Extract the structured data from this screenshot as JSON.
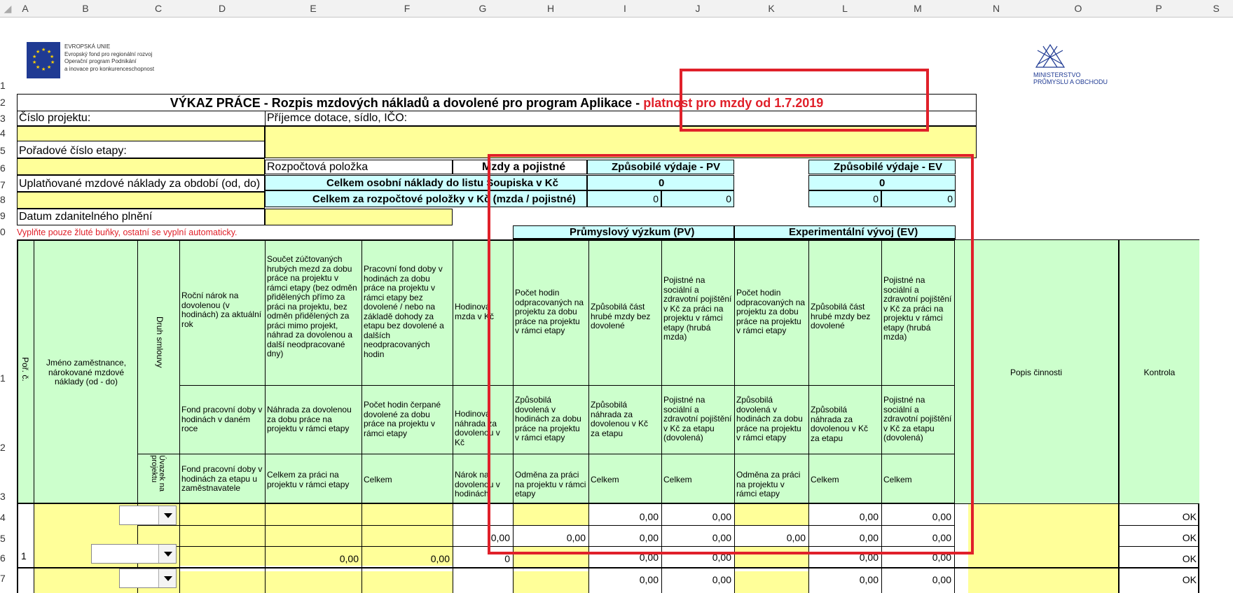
{
  "columns": [
    "A",
    "B",
    "C",
    "D",
    "E",
    "F",
    "G",
    "H",
    "I",
    "J",
    "K",
    "L",
    "M",
    "N",
    "O",
    "P",
    "S"
  ],
  "rows": [
    "1",
    "2",
    "3",
    "4",
    "5",
    "6",
    "7",
    "8",
    "9",
    "0",
    "1",
    "2",
    "3",
    "4",
    "5",
    "6",
    "7"
  ],
  "logo_eu": {
    "l1": "EVROPSKÁ UNIE",
    "l2": "Evropský fond pro regionální rozvoj",
    "l3": "Operační program Podnikání",
    "l4": "a inovace pro konkurenceschopnost"
  },
  "logo_mpo": {
    "l1": "MINISTERSTVO",
    "l2": "PRŮMYSLU A OBCHODU"
  },
  "title": {
    "main": "VÝKAZ PRÁCE - Rozpis mzdových nákladů a dovolené pro program Aplikace - ",
    "red": "platnost pro mzdy od 1.7.2019"
  },
  "labels": {
    "cislo_projektu": "Číslo projektu:",
    "prijemce": "Příjemce dotace, sídlo, IČO:",
    "poradove": "Pořadové číslo etapy:",
    "rozpoctova": "Rozpočtová položka",
    "mzdy": "Mzdy a pojistné",
    "zpusobile_pv": "Způsobilé výdaje - PV",
    "zpusobile_ev": "Způsobilé výdaje - EV",
    "uplatnovane": "Uplatňované mzdové náklady za období (od, do)",
    "celkem_osobni": "Celkem osobní náklady do listu Soupiska v Kč",
    "celkem_rozpoct": "Celkem za rozpočtové položky v Kč (mzda / pojistné)",
    "datum": "Datum zdanitelného plnění",
    "vyplnte": "Vyplňte pouze žluté buňky, ostatní se vyplní automaticky.",
    "prumyslovy": "Průmyslový výzkum (PV)",
    "experimentalni": "Experimentální vývoj (EV)"
  },
  "values": {
    "pv_total": "0",
    "ev_total": "0",
    "zero": "0",
    "num": "0,00",
    "ok": "OK",
    "one": "1"
  },
  "headers": {
    "por": "Poř. č.",
    "jmeno": "Jméno zaměstnance, nárokované mzdové náklady (od - do)",
    "druh": "Druh smlouvy",
    "uvazek": "Úvazek na projektu",
    "d1": "Roční nárok na dovolenou (v hodinách) za aktuální rok",
    "d2": "Fond pracovní doby v hodinách v daném roce",
    "d3": "Fond pracovní doby v hodinách za etapu u zaměstnavatele",
    "e1": "Součet zúčtovaných hrubých mezd za dobu práce na projektu v rámci etapy (bez odměn přidělených přímo za práci na projektu, bez odměn přidělených za práci mimo projekt, náhrad za dovolenou a další neodpracované dny)",
    "e2": "Náhrada za dovolenou za dobu práce na projektu v rámci etapy",
    "e3": "Celkem za práci na projektu v rámci etapy",
    "f1": "Pracovní fond doby v hodinách za dobu práce na projektu v rámci etapy bez dovolené / nebo na základě dohody za etapu bez dovolené a dalších neodpracovaných hodin",
    "f2": "Počet hodin čerpané dovolené za dobu práce na projektu v rámci etapy",
    "f3": "Celkem",
    "g1": "Hodinová mzda v Kč",
    "g2": "Hodinová náhrada za dovolenou v Kč",
    "g3": "Nárok na dovolenou v hodinách",
    "h1": "Počet hodin odpracovaných na projektu za dobu práce na projektu v rámci etapy",
    "h2": "Způsobilá dovolená v hodinách za dobu práce na projektu v rámci etapy",
    "h3": "Odměna za práci na projektu v rámci etapy",
    "i1": "Způsobilá část hrubé mzdy bez dovolené",
    "i2": "Způsobilá náhrada za dovolenou v Kč za etapu",
    "i3": "Celkem",
    "j1": "Pojistné na sociální a zdravotní pojištění v Kč za práci na projektu v rámci etapy (hrubá mzda)",
    "j2": "Pojistné na sociální a zdravotní pojištění v Kč za etapu (dovolená)",
    "j3": "Celkem",
    "k1": "Počet hodin odpracovaných na projektu za dobu práce na projektu v rámci etapy",
    "k2": "Způsobilá dovolená v hodinách za dobu práce na projektu v rámci etapy",
    "k3": "Odměna za práci na projektu v rámci etapy",
    "l1": "Způsobilá část hrubé mzdy bez dovolené",
    "l2": "Způsobilá náhrada za dovolenou v Kč za etapu",
    "l3": "Celkem",
    "m1": "Pojistné na sociální a zdravotní pojištění v Kč za práci na projektu v rámci etapy (hrubá mzda)",
    "m2": "Pojistné na sociální a zdravotní pojištění v Kč za etapu (dovolená)",
    "m3": "Celkem",
    "popis": "Popis činnosti",
    "kontrola": "Kontrola"
  }
}
